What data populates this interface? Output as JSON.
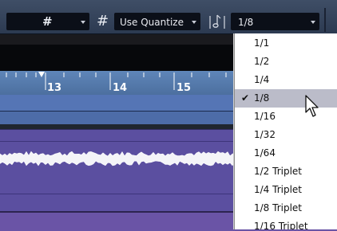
{
  "toolbar": {
    "snap_grid_glyph": "#",
    "grid_type_glyph": "#",
    "quantize_mode": "Use Quantize",
    "quantize_value": "1/8",
    "quantize_icon": "quantize-note-icon"
  },
  "ruler": {
    "bars": [
      "13",
      "14",
      "15"
    ]
  },
  "quantize_menu": {
    "items": [
      {
        "label": "1/1",
        "checked": false
      },
      {
        "label": "1/2",
        "checked": false
      },
      {
        "label": "1/4",
        "checked": false
      },
      {
        "label": "1/8",
        "checked": true
      },
      {
        "label": "1/16",
        "checked": false
      },
      {
        "label": "1/32",
        "checked": false
      },
      {
        "label": "1/64",
        "checked": false
      },
      {
        "label": "1/2 Triplet",
        "checked": false
      },
      {
        "label": "1/4 Triplet",
        "checked": false
      },
      {
        "label": "1/8 Triplet",
        "checked": false
      },
      {
        "label": "1/16 Triplet",
        "checked": false
      }
    ],
    "check_glyph": "✔"
  },
  "colors": {
    "toolbar": "#34445d",
    "ruler": "#5a80b3",
    "midi_lane": "#5575b5",
    "audio_event": "#5b4fa0",
    "menu_highlight": "#bbbcc9"
  }
}
